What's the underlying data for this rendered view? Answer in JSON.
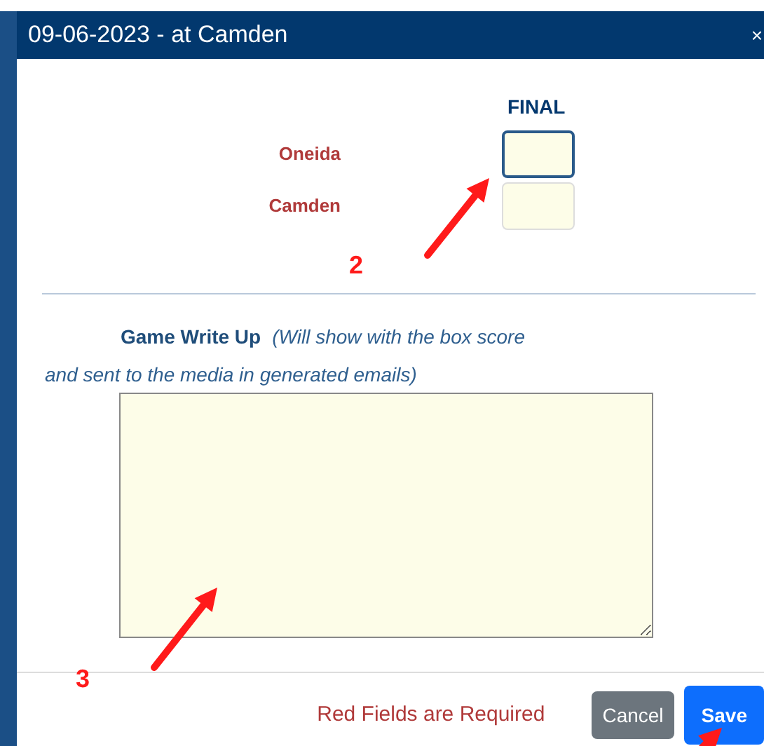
{
  "dialog": {
    "title": "09-06-2023 - at Camden",
    "close": "×"
  },
  "score": {
    "heading": "FINAL",
    "teams": [
      {
        "name": "Oneida",
        "required": true,
        "focused": true
      },
      {
        "name": "Camden",
        "required": true,
        "focused": false
      }
    ]
  },
  "write_up": {
    "label": "Game Write Up",
    "note": "(Will show with the box score",
    "note_continued": "and sent to the media in generated emails)"
  },
  "footer": {
    "message": "Red Fields are Required",
    "buttons": [
      {
        "label": "Cancel",
        "kind": "secondary"
      },
      {
        "label": "Save",
        "kind": "primary"
      }
    ]
  },
  "annotations": [
    {
      "label": "2"
    },
    {
      "label": "3"
    }
  ]
}
